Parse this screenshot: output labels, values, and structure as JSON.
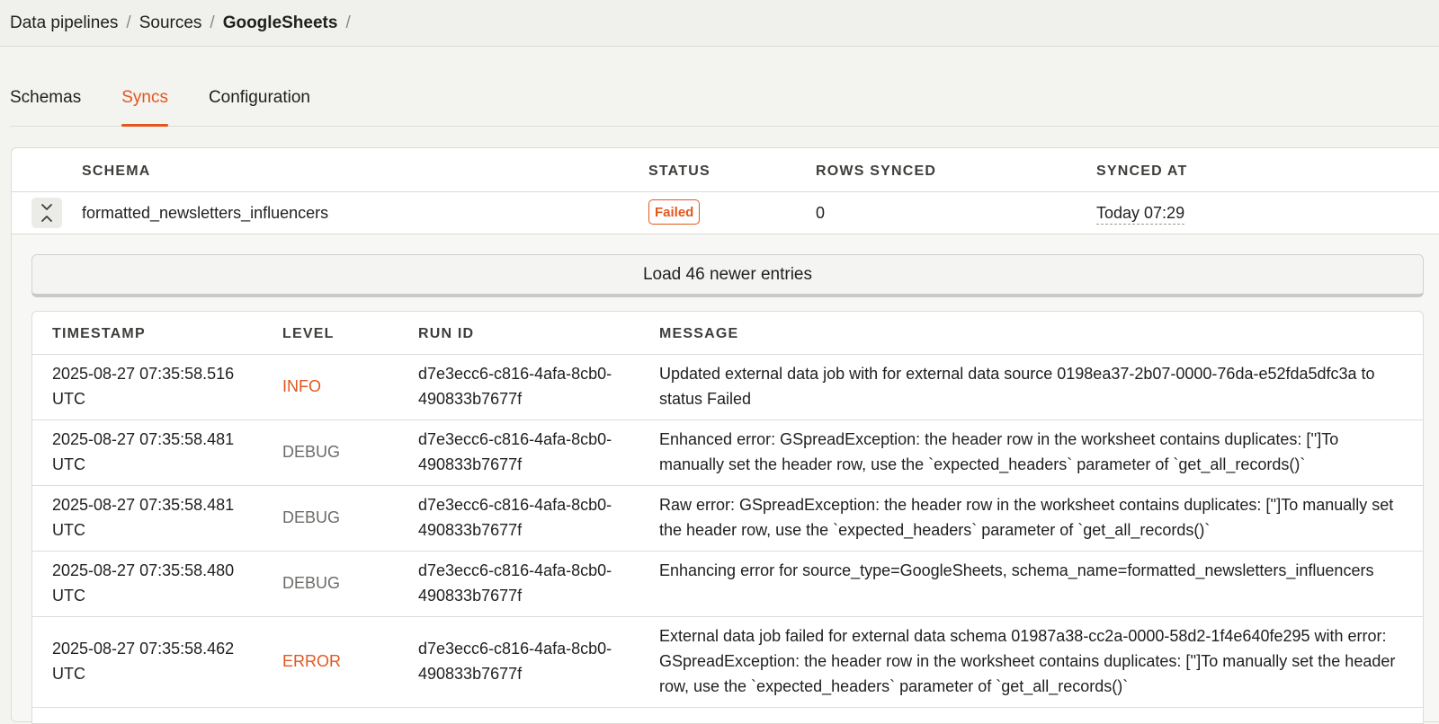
{
  "breadcrumb": {
    "items": [
      "Data pipelines",
      "Sources",
      "GoogleSheets"
    ],
    "separator": "/"
  },
  "tabs": [
    {
      "label": "Schemas",
      "active": false
    },
    {
      "label": "Syncs",
      "active": true
    },
    {
      "label": "Configuration",
      "active": false
    }
  ],
  "sync_table": {
    "headers": {
      "schema": "SCHEMA",
      "status": "STATUS",
      "rows": "ROWS SYNCED",
      "synced_at": "SYNCED AT"
    },
    "row": {
      "schema": "formatted_newsletters_influencers",
      "status": "Failed",
      "rows_synced": "0",
      "synced_at": "Today 07:29",
      "expanded": true
    }
  },
  "load_newer": {
    "label": "Load 46 newer entries"
  },
  "logs": {
    "headers": {
      "timestamp": "TIMESTAMP",
      "level": "LEVEL",
      "run_id": "RUN ID",
      "message": "MESSAGE"
    },
    "rows": [
      {
        "timestamp": "2025-08-27 07:35:58.516 UTC",
        "level": "INFO",
        "run_id": "d7e3ecc6-c816-4afa-8cb0-490833b7677f",
        "message": "Updated external data job with for external data source 0198ea37-2b07-0000-76da-e52fda5dfc3a to status Failed"
      },
      {
        "timestamp": "2025-08-27 07:35:58.481 UTC",
        "level": "DEBUG",
        "run_id": "d7e3ecc6-c816-4afa-8cb0-490833b7677f",
        "message": "Enhanced error: GSpreadException: the header row in the worksheet contains duplicates: ['']To manually set the header row, use the `expected_headers` parameter of `get_all_records()`"
      },
      {
        "timestamp": "2025-08-27 07:35:58.481 UTC",
        "level": "DEBUG",
        "run_id": "d7e3ecc6-c816-4afa-8cb0-490833b7677f",
        "message": "Raw error: GSpreadException: the header row in the worksheet contains duplicates: ['']To manually set the header row, use the `expected_headers` parameter of `get_all_records()`"
      },
      {
        "timestamp": "2025-08-27 07:35:58.480 UTC",
        "level": "DEBUG",
        "run_id": "d7e3ecc6-c816-4afa-8cb0-490833b7677f",
        "message": "Enhancing error for source_type=GoogleSheets, schema_name=formatted_newsletters_influencers"
      },
      {
        "timestamp": "2025-08-27 07:35:58.462 UTC",
        "level": "ERROR",
        "run_id": "d7e3ecc6-c816-4afa-8cb0-490833b7677f",
        "message": "External data job failed for external data schema 01987a38-cc2a-0000-58d2-1f4e640fe295 with error: GSpreadException: the header row in the worksheet contains duplicates: ['']To manually set the header row, use the `expected_headers` parameter of `get_all_records()`"
      }
    ]
  },
  "colors": {
    "accent": "#e2571e",
    "debug": "#6b6b68"
  }
}
